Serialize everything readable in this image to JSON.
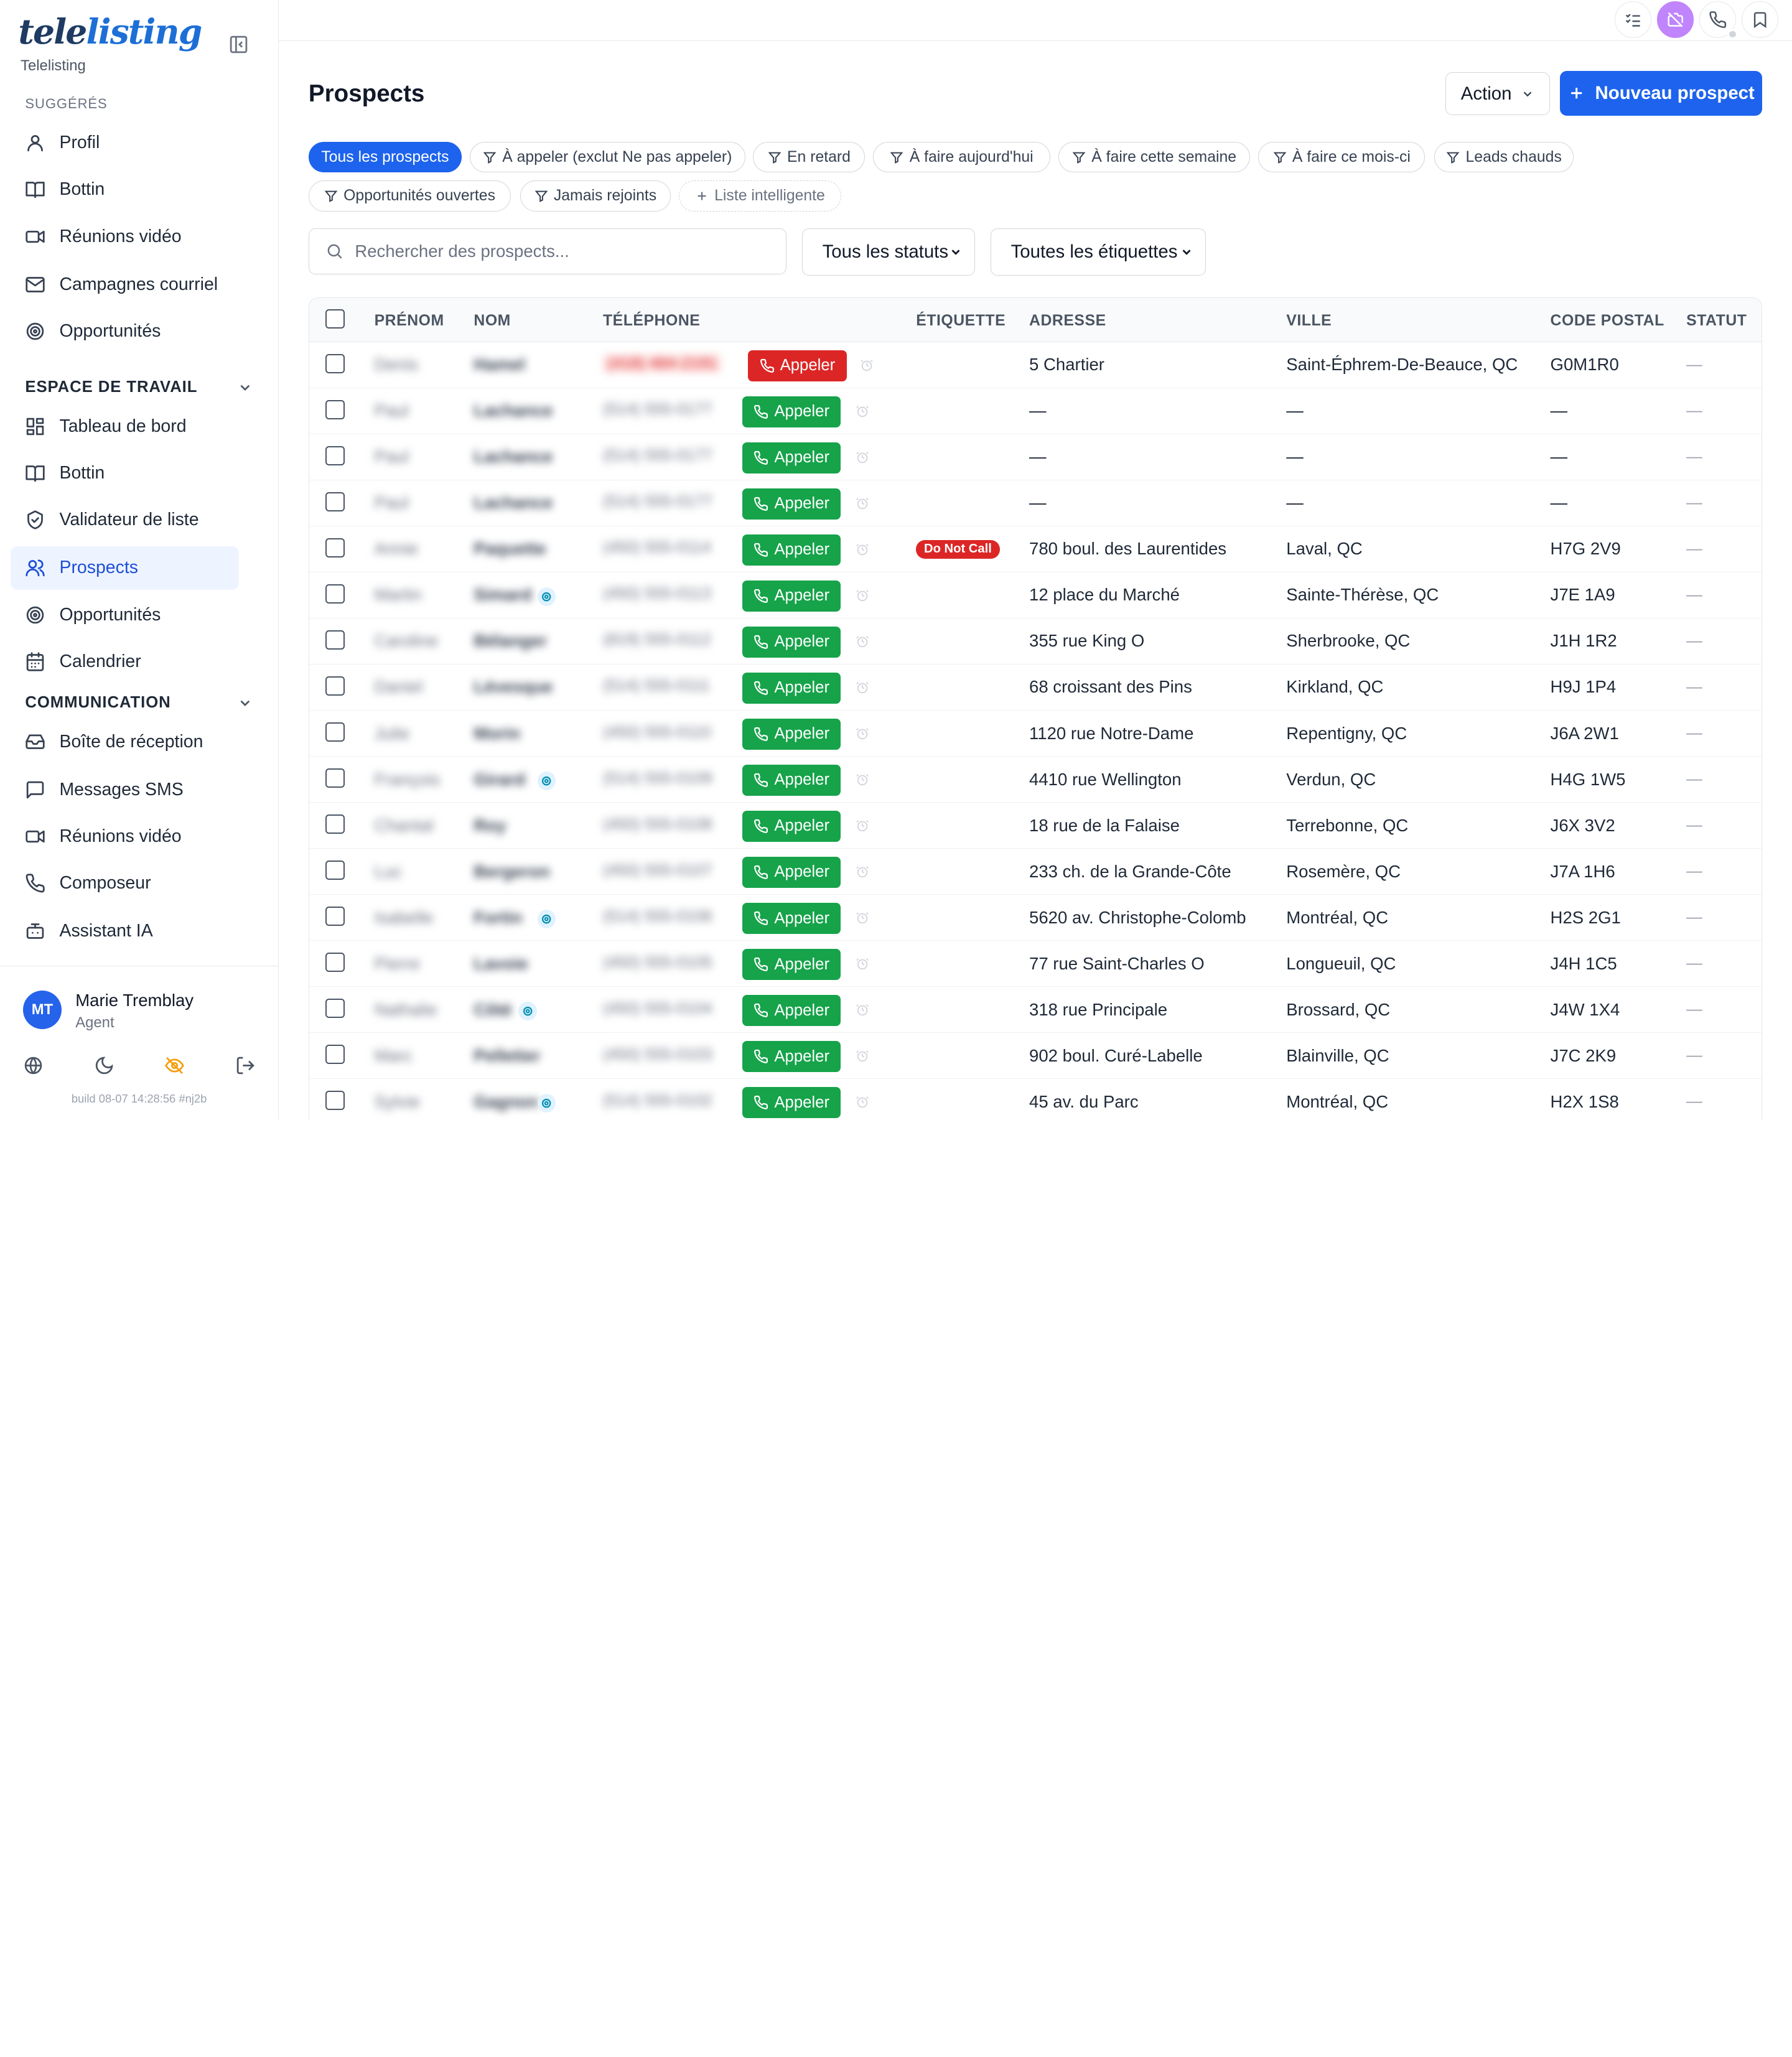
{
  "brand": {
    "logo_part1": "tele",
    "logo_part2": "listing",
    "subtitle": "Telelisting"
  },
  "sidebar": {
    "suggested_label": "SUGGÉRÉS",
    "suggested": [
      {
        "label": "Profil",
        "icon": "user-icon"
      },
      {
        "label": "Bottin",
        "icon": "book-icon"
      },
      {
        "label": "Réunions vidéo",
        "icon": "video-icon"
      },
      {
        "label": "Campagnes courriel",
        "icon": "mail-icon"
      },
      {
        "label": "Opportunités",
        "icon": "target-icon"
      }
    ],
    "workspace_label": "ESPACE DE TRAVAIL",
    "workspace": [
      {
        "label": "Tableau de bord",
        "icon": "dashboard-icon"
      },
      {
        "label": "Bottin",
        "icon": "book-icon"
      },
      {
        "label": "Validateur de liste",
        "icon": "shield-check-icon"
      },
      {
        "label": "Prospects",
        "icon": "users-icon",
        "active": true
      },
      {
        "label": "Opportunités",
        "icon": "target-icon"
      },
      {
        "label": "Calendrier",
        "icon": "calendar-icon"
      }
    ],
    "communication_label": "COMMUNICATION",
    "communication": [
      {
        "label": "Boîte de réception",
        "icon": "inbox-icon"
      },
      {
        "label": "Messages SMS",
        "icon": "message-icon"
      },
      {
        "label": "Réunions vidéo",
        "icon": "video-icon"
      },
      {
        "label": "Composeur",
        "icon": "phone-icon"
      },
      {
        "label": "Assistant IA",
        "icon": "bot-icon"
      }
    ],
    "user": {
      "initials": "MT",
      "name": "Marie Tremblay",
      "role": "Agent"
    },
    "build": "build 08-07 14:28:56 #nj2b"
  },
  "header": {
    "title": "Prospects",
    "action_label": "Action",
    "new_label": "Nouveau prospect"
  },
  "filters": [
    {
      "label": "Tous les prospects",
      "active": true
    },
    {
      "label": "À appeler (exclut Ne pas appeler)"
    },
    {
      "label": "En retard"
    },
    {
      "label": "À faire aujourd'hui"
    },
    {
      "label": "À faire cette semaine"
    },
    {
      "label": "À faire ce mois-ci"
    },
    {
      "label": "Leads chauds"
    },
    {
      "label": "Opportunités ouvertes"
    },
    {
      "label": "Jamais rejoints"
    },
    {
      "label": "Liste intelligente",
      "dashed": true
    }
  ],
  "search": {
    "placeholder": "Rechercher des prospects..."
  },
  "status_select": "Tous les statuts",
  "tag_select": "Toutes les étiquettes",
  "table": {
    "columns": [
      "PRÉNOM",
      "NOM",
      "TÉLÉPHONE",
      "ÉTIQUETTE",
      "ADRESSE",
      "VILLE",
      "CODE POSTAL",
      "STATUT"
    ],
    "call_label": "Appeler",
    "dnc_label": "Do Not Call",
    "rows": [
      {
        "first": "Denis",
        "last": "Hamel",
        "phone": "(418) 484-2191",
        "dnc": true,
        "address": "5 Chartier",
        "city": "Saint-Éphrem-De-Beauce, QC",
        "postal": "G0M1R0",
        "status": "—"
      },
      {
        "first": "Paul",
        "last": "Lachance",
        "phone": "(514) 555-0177",
        "address": "—",
        "city": "—",
        "postal": "—",
        "status": "—"
      },
      {
        "first": "Paul",
        "last": "Lachance",
        "phone": "(514) 555-0177",
        "address": "—",
        "city": "—",
        "postal": "—",
        "status": "—"
      },
      {
        "first": "Paul",
        "last": "Lachance",
        "phone": "(514) 555-0177",
        "address": "—",
        "city": "—",
        "postal": "—",
        "status": "—"
      },
      {
        "first": "Annie",
        "last": "Paquette",
        "phone": "(450) 555-0114",
        "tag": "Do Not Call",
        "address": "780 boul. des Laurentides",
        "city": "Laval, QC",
        "postal": "H7G 2V9",
        "status": "—"
      },
      {
        "first": "Martin",
        "last": "Simard",
        "phone": "(450) 555-0113",
        "email": true,
        "address": "12 place du Marché",
        "city": "Sainte-Thérèse, QC",
        "postal": "J7E 1A9",
        "status": "—"
      },
      {
        "first": "Caroline",
        "last": "Bélanger",
        "phone": "(819) 555-0112",
        "address": "355 rue King O",
        "city": "Sherbrooke, QC",
        "postal": "J1H 1R2",
        "status": "—"
      },
      {
        "first": "Daniel",
        "last": "Lévesque",
        "phone": "(514) 555-0111",
        "address": "68 croissant des Pins",
        "city": "Kirkland, QC",
        "postal": "H9J 1P4",
        "status": "—"
      },
      {
        "first": "Julie",
        "last": "Morin",
        "phone": "(450) 555-0110",
        "address": "1120 rue Notre-Dame",
        "city": "Repentigny, QC",
        "postal": "J6A 2W1",
        "status": "—"
      },
      {
        "first": "François",
        "last": "Girard",
        "phone": "(514) 555-0109",
        "email": true,
        "address": "4410 rue Wellington",
        "city": "Verdun, QC",
        "postal": "H4G 1W5",
        "status": "—"
      },
      {
        "first": "Chantal",
        "last": "Roy",
        "phone": "(450) 555-0108",
        "address": "18 rue de la Falaise",
        "city": "Terrebonne, QC",
        "postal": "J6X 3V2",
        "status": "—"
      },
      {
        "first": "Luc",
        "last": "Bergeron",
        "phone": "(450) 555-0107",
        "address": "233 ch. de la Grande-Côte",
        "city": "Rosemère, QC",
        "postal": "J7A 1H6",
        "status": "—"
      },
      {
        "first": "Isabelle",
        "last": "Fortin",
        "phone": "(514) 555-0106",
        "email": true,
        "address": "5620 av. Christophe-Colomb",
        "city": "Montréal, QC",
        "postal": "H2S 2G1",
        "status": "—"
      },
      {
        "first": "Pierre",
        "last": "Lavoie",
        "phone": "(450) 555-0105",
        "address": "77 rue Saint-Charles O",
        "city": "Longueuil, QC",
        "postal": "J4H 1C5",
        "status": "—"
      },
      {
        "first": "Nathalie",
        "last": "Côté",
        "phone": "(450) 555-0104",
        "email": true,
        "address": "318 rue Principale",
        "city": "Brossard, QC",
        "postal": "J4W 1X4",
        "status": "—"
      },
      {
        "first": "Marc",
        "last": "Pelletier",
        "phone": "(450) 555-0103",
        "address": "902 boul. Curé-Labelle",
        "city": "Blainville, QC",
        "postal": "J7C 2K9",
        "status": "—"
      },
      {
        "first": "Sylvie",
        "last": "Gagnon",
        "phone": "(514) 555-0102",
        "email": true,
        "address": "45 av. du Parc",
        "city": "Montréal, QC",
        "postal": "H2X 1S8",
        "status": "—"
      }
    ]
  }
}
